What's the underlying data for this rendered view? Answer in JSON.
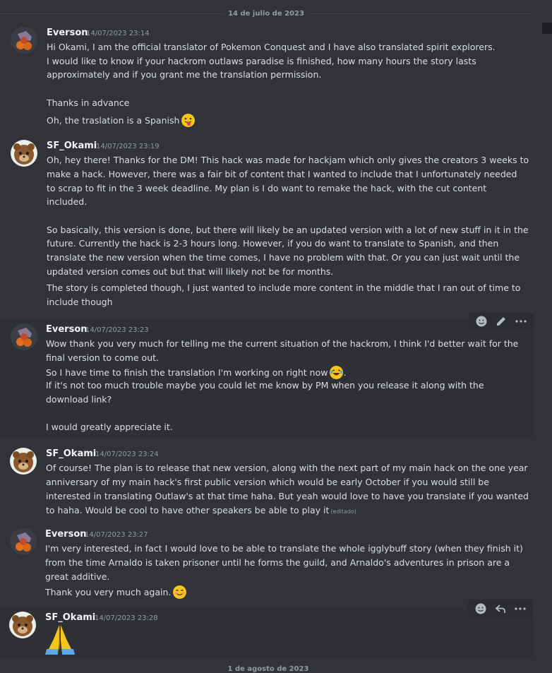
{
  "date_dividers": {
    "top": "14 de julio de 2023",
    "bottom": "1 de agosto de 2023"
  },
  "messages": [
    {
      "user": "Everson",
      "timestamp": "14/07/2023 23:14",
      "lines": [
        "Hi Okami, I am the official translator of Pokemon Conquest and I have also translated spirit explorers.",
        "I would like to know if your hackrom outlaws paradise is finished, how many hours the story lasts",
        "approximately and if you grant me the translation permission.",
        "Thanks in advance",
        "Oh, the traslation is a Spanish"
      ]
    },
    {
      "user": "SF_Okami",
      "timestamp": "14/07/2023 23:19",
      "lines": [
        "Oh, hey there! Thanks for the DM! This hack was made for hackjam which only gives the creators 3 weeks to",
        "make a hack. However, there was a fair bit of content that I wanted to include that I unfortunately needed",
        "to scrap to fit in the 3 week deadline. My plan is I do want to remake the hack, with the cut content",
        "included.",
        "So basically, this version is done, but there will likely be an updated version with a lot of new stuff in it in the",
        "future. Currently the hack is 2-3 hours long. However, if you do want to translate to Spanish, and then",
        "translate the new version when the time comes, I have no problem with that. Or you can just wait until the",
        "updated version comes out but that will likely not be for months.",
        "The story is completed though, I just wanted to include more content in the middle that I ran out of time to",
        "include though"
      ]
    },
    {
      "user": "Everson",
      "timestamp": "14/07/2023 23:23",
      "lines": [
        "Wow thank you very much for telling me the current situation of the hackrom, I think I'd better wait for the",
        "final version to come out.",
        "So I have time to finish the translation I'm working on right now",
        "If it's not too much trouble maybe you could let me know by PM when you release it along with the",
        "download link?",
        "I would greatly appreciate it."
      ]
    },
    {
      "user": "SF_Okami",
      "timestamp": "14/07/2023 23:24",
      "lines": [
        "Of course! The plan is to release that new version, along with the next part of my main hack on the one year",
        "anniversary of my main hack's first public version which would be early October if you would still be",
        "interested in translating Outlaw's at that time haha. But yeah would love to have you translate if you wanted",
        "to haha. Would be cool to have other speakers be able to play it"
      ],
      "edited": "(editado)"
    },
    {
      "user": "Everson",
      "timestamp": "14/07/2023 23:27",
      "lines": [
        "I'm very interested, in fact I would love to be able to translate the whole igglybuff story (when they finish it)",
        "from the time Arnaldo is taken prisoner until he forms the guild, and Arnaldo's adventures in prison are a",
        "great additive.",
        "Thank you very much again."
      ]
    },
    {
      "user": "SF_Okami",
      "timestamp": "14/07/2023 23:28",
      "lines": []
    }
  ],
  "colors": {
    "background": "#313338",
    "hover": "#2e3035",
    "username": "#f2f3f5",
    "text": "#dbdee1",
    "muted": "#949ba4"
  },
  "icons": [
    "add-reaction-icon",
    "edit-icon",
    "more-icon",
    "reply-icon",
    "tongue-emoji",
    "laugh-emoji",
    "smile-emoji",
    "pray-emoji"
  ]
}
